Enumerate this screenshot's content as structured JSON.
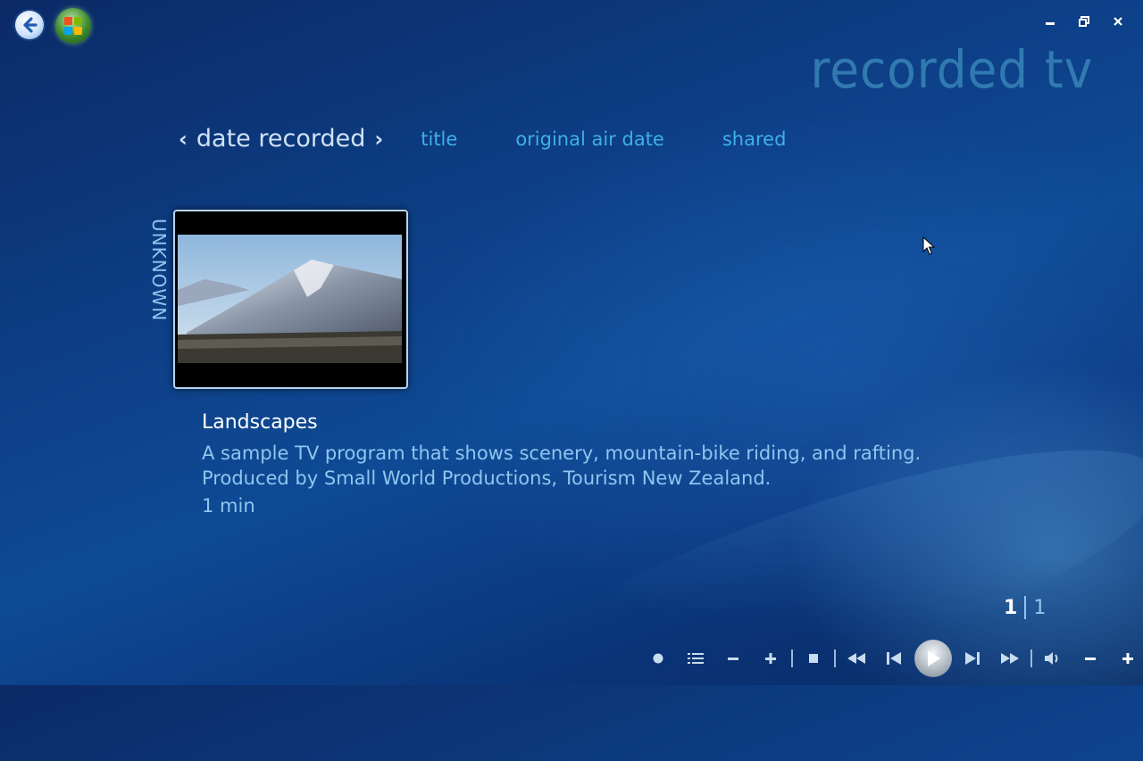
{
  "header": {
    "page_title": "recorded tv"
  },
  "sort": {
    "active": "date recorded",
    "options": [
      "title",
      "original air date",
      "shared"
    ]
  },
  "group": {
    "label": "UNKNOWN"
  },
  "program": {
    "title": "Landscapes",
    "description_line1": "A sample TV program that shows scenery, mountain-bike riding, and rafting.",
    "description_line2": "Produced by Small World Productions, Tourism New Zealand.",
    "duration": "1 min"
  },
  "pager": {
    "current": "1",
    "total": "1"
  },
  "icons": {
    "back": "back-arrow-icon",
    "start": "windows-start-icon",
    "minimize": "minimize-icon",
    "restore": "restore-icon",
    "close": "close-icon",
    "record": "record-icon",
    "guide": "guide-list-icon",
    "channel_down": "minus-icon",
    "channel_up": "plus-icon",
    "stop": "stop-icon",
    "rewind": "rewind-icon",
    "prev": "skip-back-icon",
    "play": "play-icon",
    "next": "skip-forward-icon",
    "fast_forward": "fast-forward-icon",
    "mute": "volume-icon",
    "vol_down": "minus-icon",
    "vol_up": "plus-icon"
  },
  "colors": {
    "accent": "#3fb0e6",
    "title_text": "#ffffff",
    "secondary_text": "#8fc6ef"
  }
}
